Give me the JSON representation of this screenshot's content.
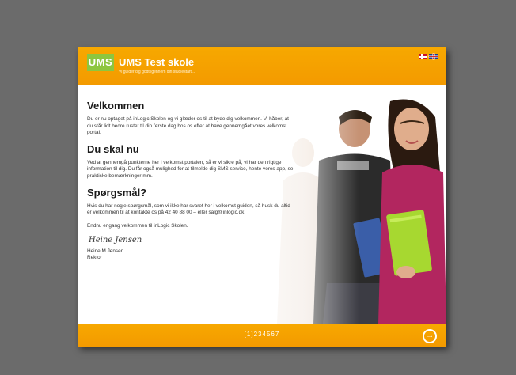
{
  "header": {
    "logo": "UMS",
    "title": "UMS Test skole",
    "subtitle": "Vi guider dig godt igennem din studiestart...",
    "languages": [
      "Dansk",
      "English"
    ]
  },
  "sections": [
    {
      "heading": "Velkommen",
      "text": "Du er nu optaget på inLogic Skolen og vi glæder os til at byde dig velkommen. Vi håber, at du står lidt bedre rustet til din første dag hos os efter at have gennemgået vores velkomst portal."
    },
    {
      "heading": "Du skal nu",
      "text": "Ved at gennemgå punkterne her i velkomst portalen, så er vi sikre på, vi har den rigtige information til dig. Du får også mulighed for at tilmelde dig SMS service, hente vores app, se praktiske bemærkninger mm."
    },
    {
      "heading": "Spørgsmål?",
      "text": "Hvis du har nogle spørgsmål, som vi ikke har svaret her i velkomst guiden, så husk du altid er velkommen til at kontakte os på 42 40 88 00 – eller salg@inlogic.dk."
    }
  ],
  "closing": "Endnu engang velkommen til inLogic Skolen.",
  "signature": {
    "script": "Heine Jensen",
    "name": "Heine M Jensen",
    "role": "Rektor"
  },
  "footer": {
    "pages": [
      "[1]",
      "2",
      "3",
      "4",
      "5",
      "6",
      "7"
    ],
    "current_page": 1,
    "next_icon": "arrow-right-circle"
  },
  "colors": {
    "background": "#6b6b6b",
    "accent_orange": "#f7a800",
    "logo_green": "#8dc63f"
  }
}
